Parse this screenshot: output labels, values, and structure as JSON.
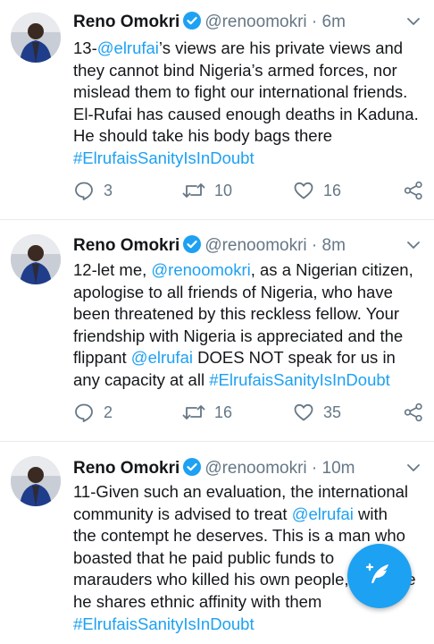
{
  "tweets": [
    {
      "name": "Reno Omokri",
      "handle": "@renoomokri",
      "sep": "·",
      "time": "6m",
      "lines": [
        [
          {
            "t": "13-"
          },
          {
            "t": "@elrufai",
            "link": true
          },
          {
            "t": "’s views are his private views and"
          }
        ],
        [
          {
            "t": "they cannot bind Nigeria’s armed forces, nor"
          }
        ],
        [
          {
            "t": "mislead them to fight our international friends."
          }
        ],
        [
          {
            "t": "El-Rufai has caused enough deaths in Kaduna."
          }
        ],
        [
          {
            "t": "He should take his body bags there"
          }
        ],
        [
          {
            "t": "#ElrufaisSanityIsInDoubt",
            "link": true
          }
        ]
      ],
      "replies": "3",
      "retweets": "10",
      "likes": "16"
    },
    {
      "name": "Reno Omokri",
      "handle": "@renoomokri",
      "sep": "·",
      "time": "8m",
      "lines": [
        [
          {
            "t": "12-let me, "
          },
          {
            "t": "@renoomokri",
            "link": true
          },
          {
            "t": ", as a Nigerian citizen,"
          }
        ],
        [
          {
            "t": "apologise to all friends of Nigeria, who have"
          }
        ],
        [
          {
            "t": "been threatened by this reckless fellow. Your"
          }
        ],
        [
          {
            "t": "friendship with Nigeria is appreciated and the"
          }
        ],
        [
          {
            "t": "flippant "
          },
          {
            "t": "@elrufai",
            "link": true
          },
          {
            "t": " DOES NOT speak for us in"
          }
        ],
        [
          {
            "t": "any capacity at all "
          },
          {
            "t": "#ElrufaisSanityIsInDoubt",
            "link": true
          }
        ]
      ],
      "replies": "2",
      "retweets": "16",
      "likes": "35"
    },
    {
      "name": "Reno Omokri",
      "handle": "@renoomokri",
      "sep": "·",
      "time": "10m",
      "lines": [
        [
          {
            "t": "11-Given such an evaluation, the international"
          }
        ],
        [
          {
            "t": "community is advised to treat "
          },
          {
            "t": "@elrufai",
            "link": true
          },
          {
            "t": " with"
          }
        ],
        [
          {
            "t": "the contempt he deserves. This is a man who"
          }
        ],
        [
          {
            "t": "boasted that he paid public funds to"
          }
        ],
        [
          {
            "t": "marauders who killed his own people, because"
          }
        ],
        [
          {
            "t": "he shares ethnic affinity with them"
          }
        ],
        [
          {
            "t": "#ElrufaisSanityIsInDoubt",
            "link": true
          }
        ]
      ]
    }
  ],
  "colors": {
    "accent": "#1da1f2",
    "muted": "#657786",
    "text": "#14171a",
    "divider": "#e6ecf0"
  },
  "icons": [
    "verified-badge-icon",
    "chevron-down-icon",
    "reply-icon",
    "retweet-icon",
    "like-icon",
    "share-icon",
    "compose-tweet-icon"
  ]
}
